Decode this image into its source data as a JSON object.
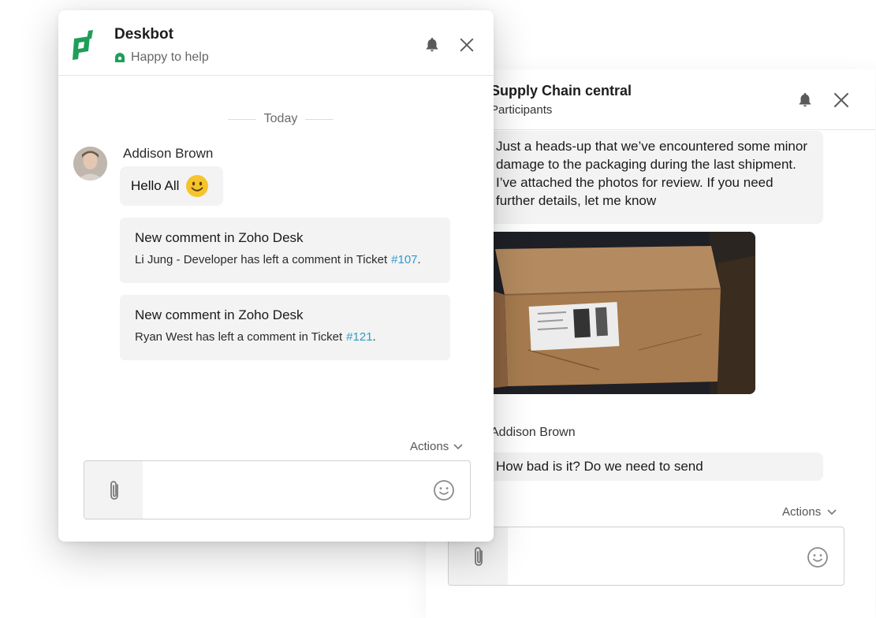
{
  "back_chat": {
    "title": "Supply Chain central",
    "subtitle": "Participants",
    "messages": [
      {
        "text": "Just a heads-up that we’ve encountered some minor damage to the packaging during the last shipment. I’ve attached the photos for review. If you need further details, let me know"
      }
    ],
    "photo_alt": "Damaged cardboard package",
    "reply_sender": "Addison Brown",
    "reply_text": "How bad is it? Do we need to send",
    "actions_label": "Actions",
    "icons": {
      "bell": "bell-icon",
      "close": "close-icon",
      "attach": "paperclip-icon",
      "emoji": "emoji-icon"
    }
  },
  "front_chat": {
    "bot_name": "Deskbot",
    "status": "Happy to help",
    "day_label": "Today",
    "sender": "Addison Brown",
    "greeting": "Hello All",
    "cards": [
      {
        "title": "New comment in Zoho Desk",
        "body": "Li Jung - Developer has left a comment in Ticket",
        "ticket": "#107",
        "suffix": "."
      },
      {
        "title": "New comment in Zoho Desk",
        "body": "Ryan West has left a comment in Ticket",
        "ticket": "#121",
        "suffix": "."
      }
    ],
    "actions_label": "Actions",
    "colors": {
      "brand_green": "#1e9e5a",
      "link_blue": "#2f9bc6",
      "bubble_bg": "#f3f3f3"
    },
    "icons": {
      "logo": "deskbot-logo",
      "bell": "bell-icon",
      "close": "close-icon",
      "attach": "paperclip-icon",
      "emoji": "emoji-icon",
      "smile": "smile-emoji-icon"
    }
  }
}
